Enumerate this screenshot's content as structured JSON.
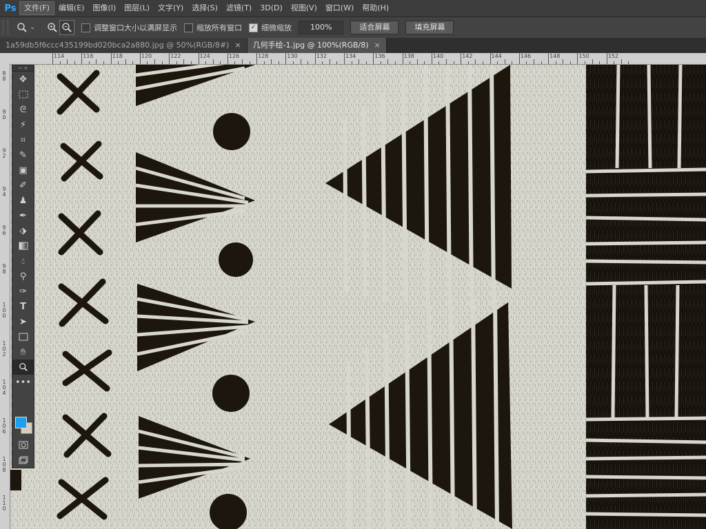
{
  "app": {
    "logo": "Ps"
  },
  "menu": [
    "文件(F)",
    "编辑(E)",
    "图像(I)",
    "图层(L)",
    "文字(Y)",
    "选择(S)",
    "滤镜(T)",
    "3D(D)",
    "视图(V)",
    "窗口(W)",
    "帮助(H)"
  ],
  "options": {
    "resize_window_label": "调整窗口大小以满屏显示",
    "zoom_all_label": "缩放所有窗口",
    "scrubby_zoom_label": "细微缩放",
    "zoom_value": "100%",
    "fit_screen": "适合屏幕",
    "fill_screen": "填充屏幕"
  },
  "tabs": [
    {
      "title": "1a59db5f6ccc435199bd020bca2a880.jpg @ 50%(RGB/8#)",
      "close": "×",
      "active": false
    },
    {
      "title": "几何手绘-1.jpg @ 100%(RGB/8)",
      "close": "×",
      "active": true
    }
  ],
  "ruler_top_labels": [
    "114",
    "116",
    "118",
    "120",
    "122",
    "124",
    "126",
    "128",
    "130",
    "132",
    "134",
    "136",
    "138",
    "140",
    "142",
    "144",
    "146",
    "148",
    "150",
    "152"
  ],
  "ruler_left_labels": [
    "88",
    "90",
    "92",
    "94",
    "96",
    "98",
    "100",
    "102",
    "104",
    "106",
    "108",
    "110"
  ],
  "colors": {
    "foreground": "#1aa0ef",
    "background": "#d7cdbd",
    "ink": "#1c160c",
    "paper": "#d8d7cd",
    "accent": "#31a8ff"
  }
}
